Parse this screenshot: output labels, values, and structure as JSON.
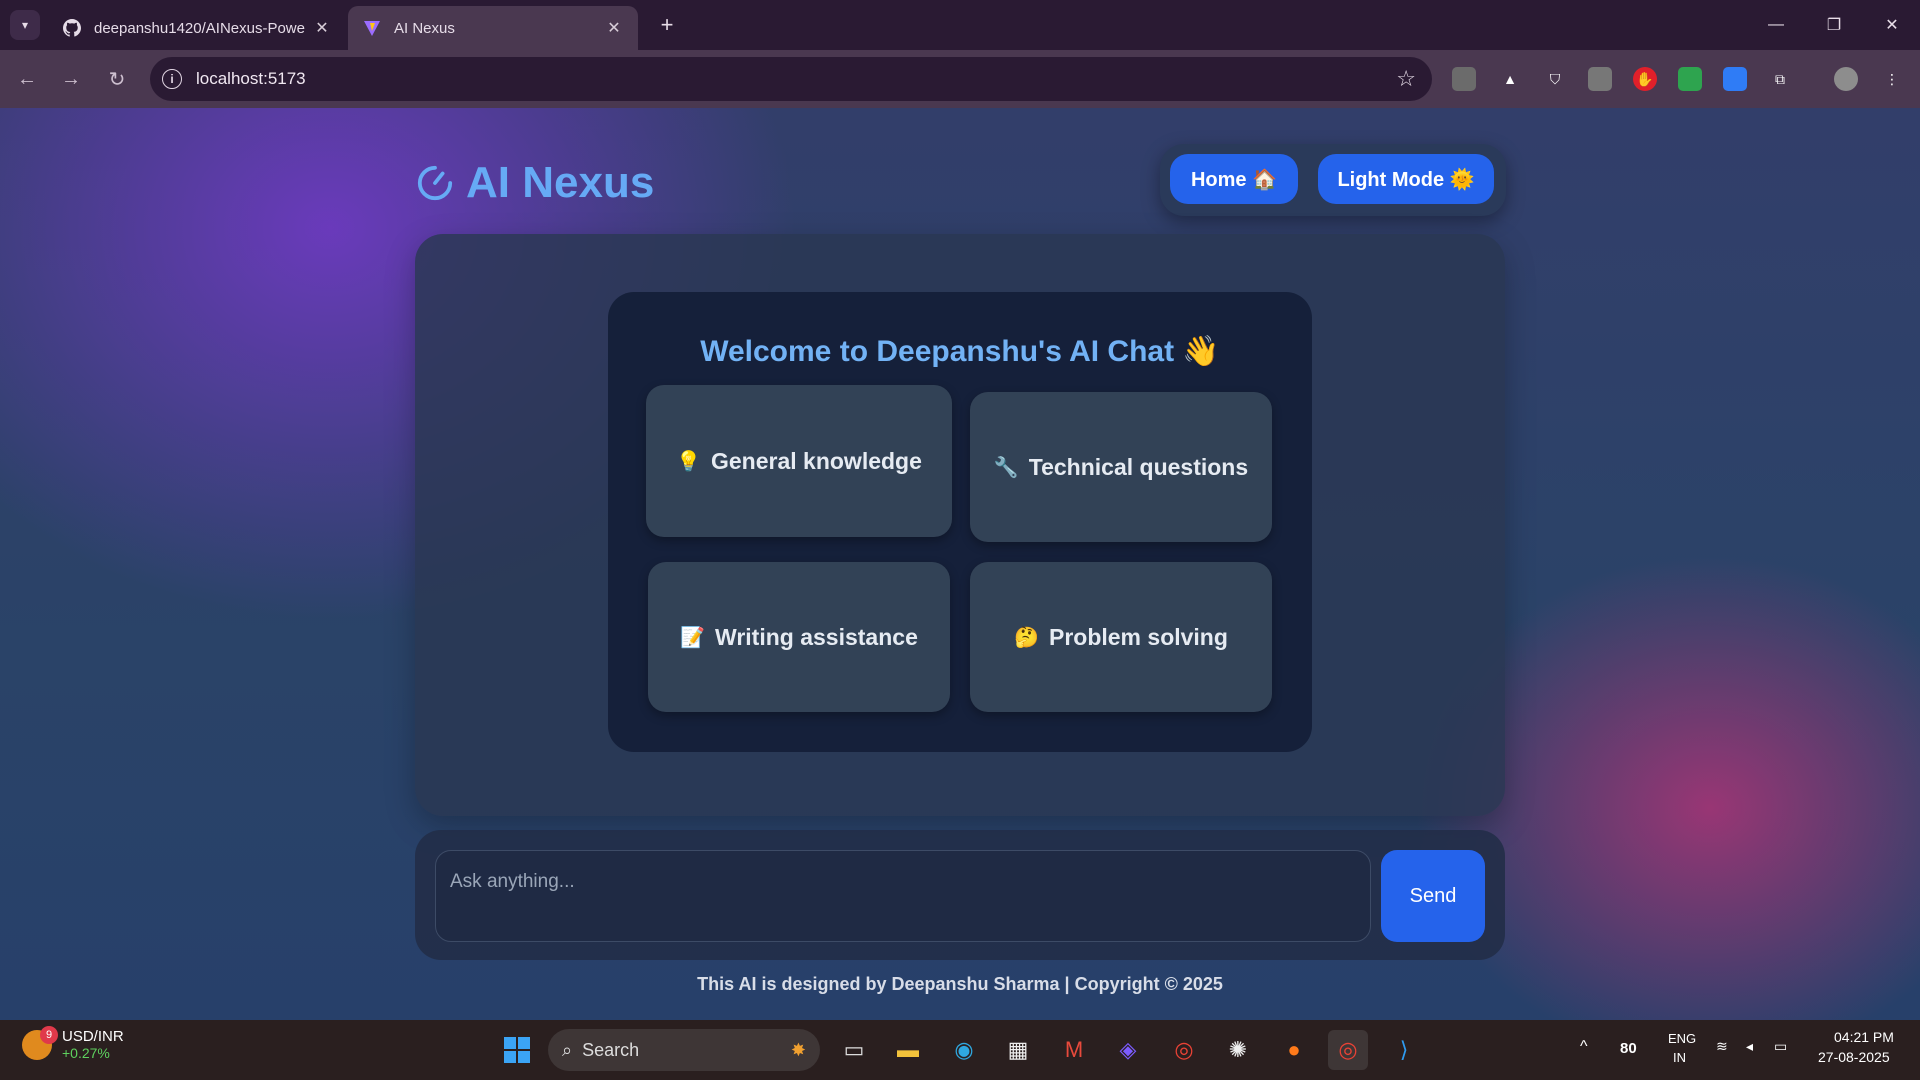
{
  "browser": {
    "tabs": [
      {
        "title": "deepanshu1420/AINexus-Powe",
        "icon": "github-icon"
      },
      {
        "title": "AI Nexus",
        "icon": "vite-icon"
      }
    ],
    "address": "localhost:5173"
  },
  "app": {
    "brand": "AI Nexus",
    "nav": {
      "home_label": "Home 🏠",
      "theme_label": "Light Mode 🌞"
    },
    "welcome": "Welcome to Deepanshu's AI Chat 👋",
    "suggestions": [
      {
        "emoji": "💡",
        "label": "General knowledge"
      },
      {
        "emoji": "🔧",
        "label": "Technical questions"
      },
      {
        "emoji": "📝",
        "label": "Writing assistance"
      },
      {
        "emoji": "🤔",
        "label": "Problem solving"
      }
    ],
    "input_placeholder": "Ask anything...",
    "send_label": "Send",
    "footer": "This AI is designed by Deepanshu Sharma | Copyright © 2025"
  },
  "taskbar": {
    "widget": {
      "name": "USD/INR",
      "change": "+0.27%",
      "badge": "9"
    },
    "search_label": "Search",
    "tray": {
      "temp": "80",
      "lang": "ENG",
      "region": "IN",
      "time": "04:21 PM",
      "date": "27-08-2025"
    }
  },
  "colors": {
    "accent": "#2563eb",
    "brand": "#66aaf5"
  }
}
